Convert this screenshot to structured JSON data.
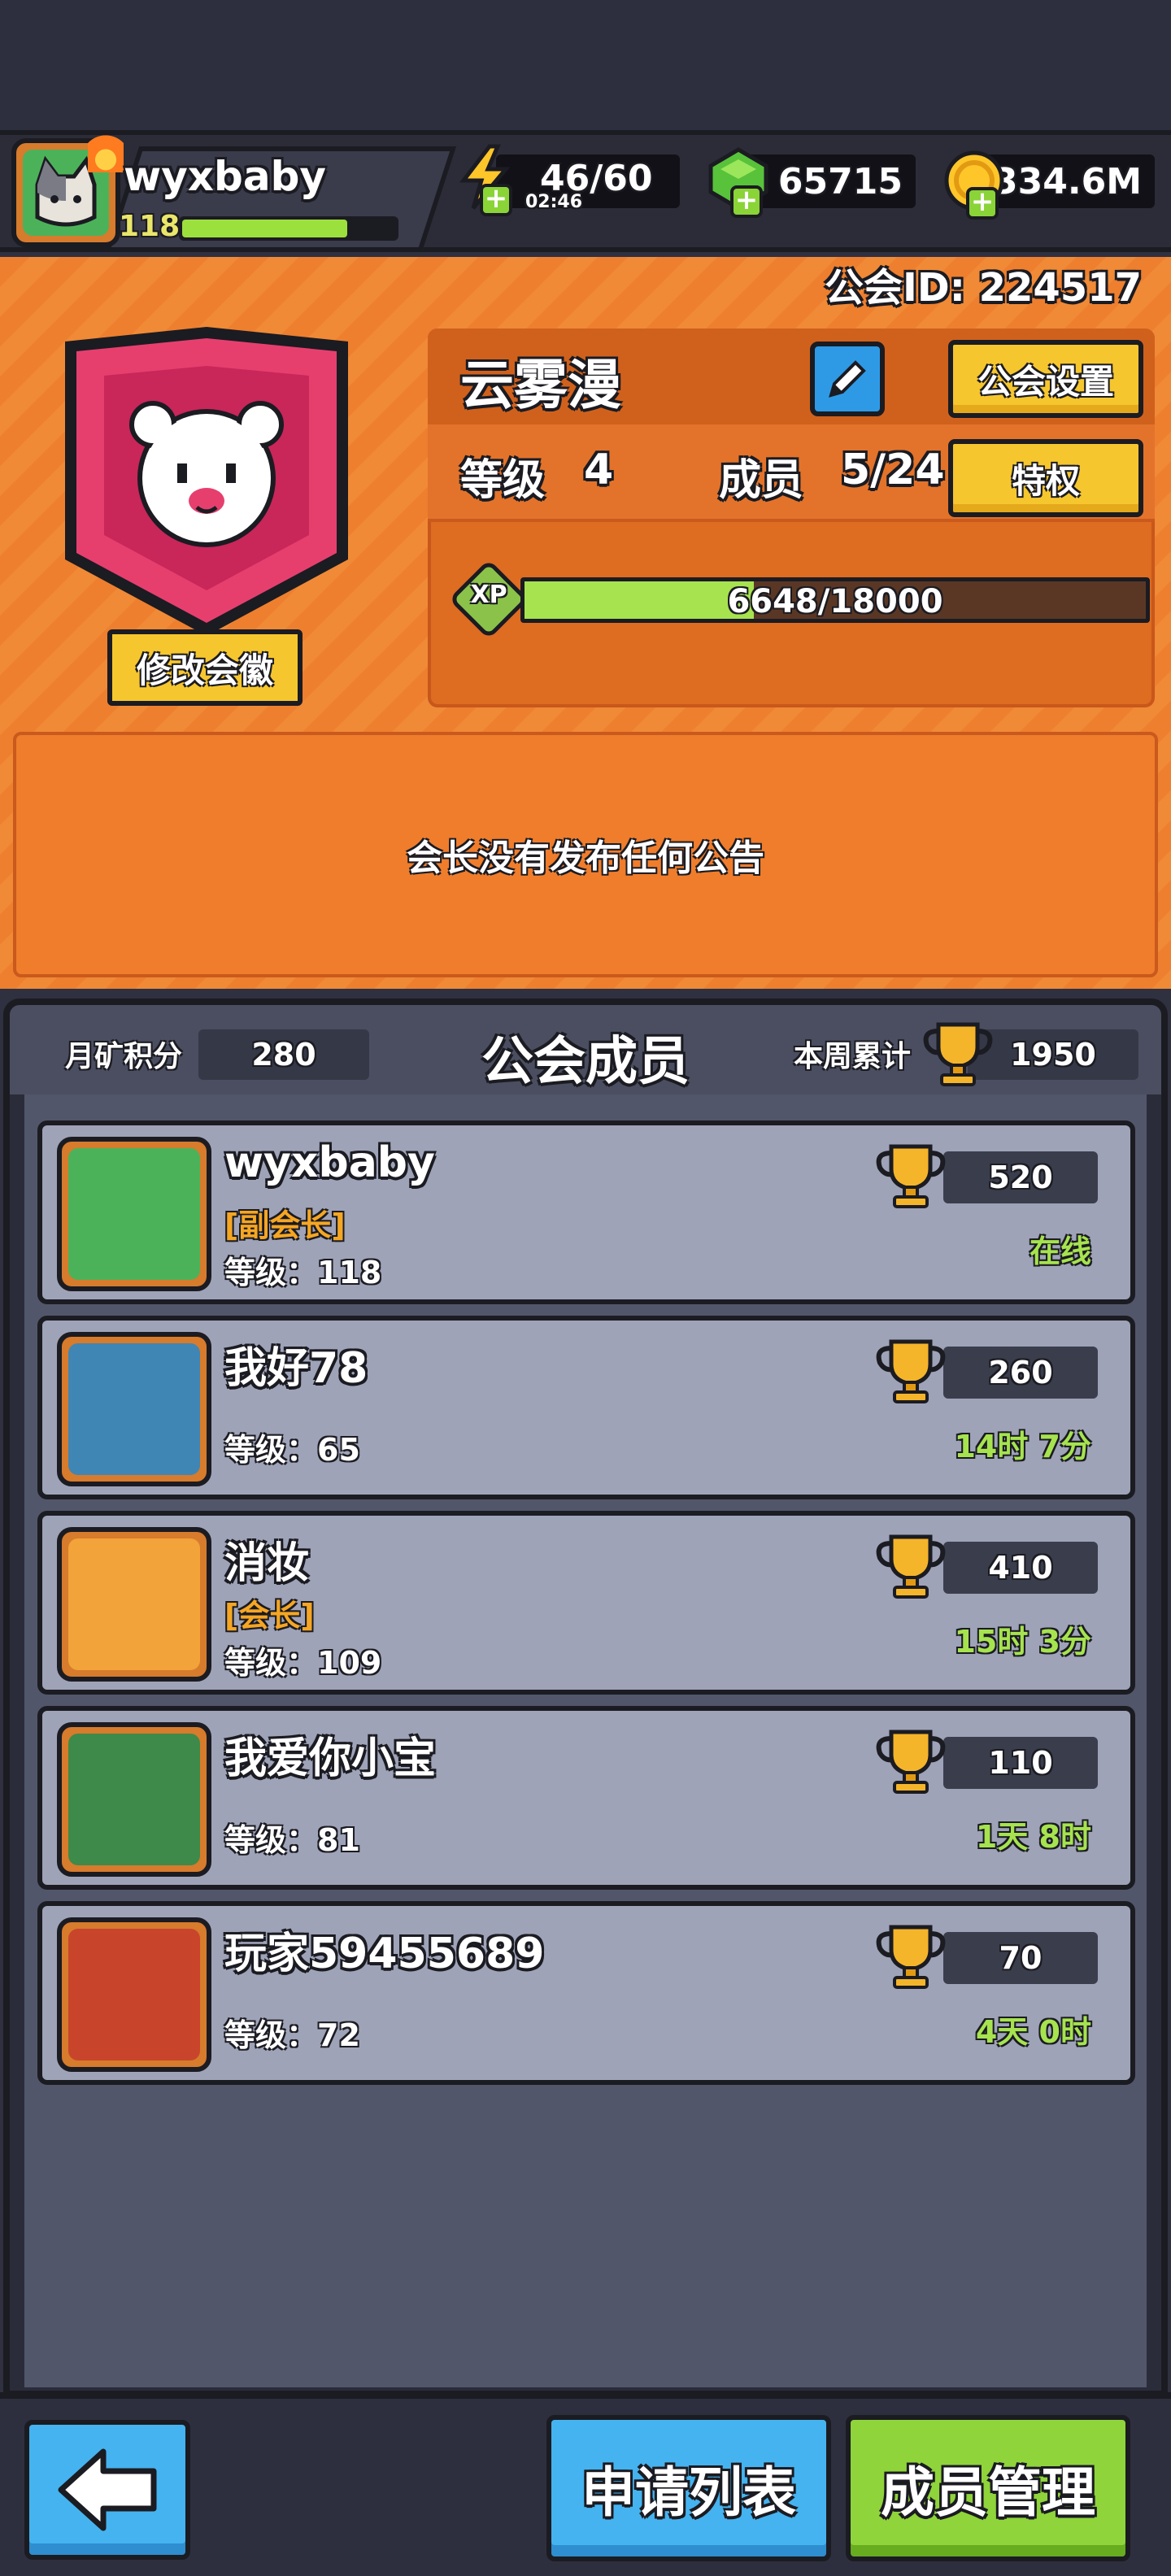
{
  "player": {
    "name": "wyxbaby",
    "level": "118",
    "xp_fraction": 0.78,
    "avatar_icon": "cat-icon"
  },
  "resources": {
    "energy": "46/60",
    "energy_timer": "02:46",
    "gems": "65715",
    "gold": "334.6M"
  },
  "guild": {
    "id_label": "公会ID: 224517",
    "name": "云雾漫",
    "settings_label": "公会设置",
    "level_label": "等级",
    "level_value": "4",
    "members_label": "成员",
    "members_value": "5/24",
    "privilege_label": "特权",
    "xp_badge": "XP",
    "xp_text": "6648/18000",
    "xp_fraction": 0.369,
    "edit_badge_label": "修改会徽",
    "emblem_icon": "bear-icon",
    "announcement": "会长没有发布任何公告"
  },
  "members_panel": {
    "title": "公会成员",
    "monthly_label": "月矿积分",
    "monthly_value": "280",
    "weekly_label": "本周累计",
    "weekly_value": "1950",
    "members": [
      {
        "name": "wyxbaby",
        "role": "[副会长]",
        "level": "等级：118",
        "score": "520",
        "status": "在线",
        "avatar": "cat-icon",
        "color": "#4cb25a"
      },
      {
        "name": "我好78",
        "role": "",
        "level": "等级：65",
        "score": "260",
        "status": "14时 7分",
        "avatar": "rhino-icon",
        "color": "#3f86b5"
      },
      {
        "name": "消妆",
        "role": "[会长]",
        "level": "等级：109",
        "score": "410",
        "status": "15时 3分",
        "avatar": "girl-icon",
        "color": "#f2a33a"
      },
      {
        "name": "我爱你小宝",
        "role": "",
        "level": "等级：81",
        "score": "110",
        "status": "1天 8时",
        "avatar": "panda-icon",
        "color": "#3d8a4a"
      },
      {
        "name": "玩家59455689",
        "role": "",
        "level": "等级：72",
        "score": "70",
        "status": "4天 0时",
        "avatar": "ninja-icon",
        "color": "#c8452b"
      }
    ]
  },
  "bottom": {
    "apply_list_label": "申请列表",
    "member_manage_label": "成员管理"
  },
  "colors": {
    "orange_bg": "#ee7f2e",
    "card_bg": "#9ea3b8",
    "gold_button": "#f6c62e",
    "green_text": "#a6e34f"
  }
}
